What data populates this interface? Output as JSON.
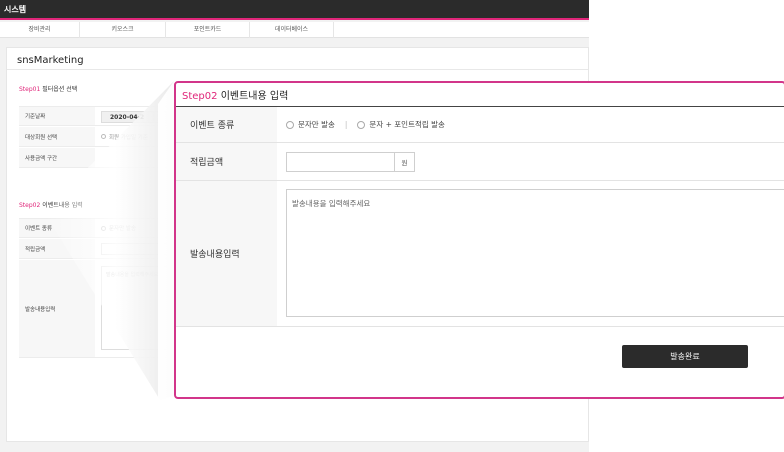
{
  "app": {
    "title": "시스템",
    "menu": [
      "장비관리",
      "키오스크",
      "포인트카드",
      "데이터베이스"
    ]
  },
  "panel": {
    "title": "snsMarketing",
    "step1": {
      "prefix": "Step01",
      "title": "필터옵션 선택",
      "rows": [
        {
          "label": "기준날짜",
          "value": "2020-04-2"
        },
        {
          "label": "대상회원 선택",
          "value": "회원 가입일 기준"
        },
        {
          "label": "사용금액 구간",
          "value": ""
        }
      ]
    },
    "step2": {
      "prefix": "Step02",
      "title": "이벤트내용 입력",
      "rows": [
        {
          "label": "이벤트 종류",
          "value": "문자만 발송"
        },
        {
          "label": "적립금액",
          "value": ""
        },
        {
          "label": "발송내용입력",
          "value": "발송내용을 입력해주세요"
        }
      ]
    }
  },
  "zoom": {
    "prefix": "Step02",
    "title": "이벤트내용 입력",
    "event_type_label": "이벤트 종류",
    "radio_options": [
      "문자만 발송",
      "문자 + 포인트적립 발송"
    ],
    "amount_label": "적립금액",
    "amount_value": "",
    "amount_unit": "원",
    "message_label": "발송내용입력",
    "message_placeholder": "발송내용을 입력해주세요",
    "send_button": "발송완료"
  },
  "colors": {
    "accent": "#e0267a",
    "modal_border": "#d2358a",
    "topbar": "#2b2b2b",
    "button": "#2b2b2b"
  }
}
